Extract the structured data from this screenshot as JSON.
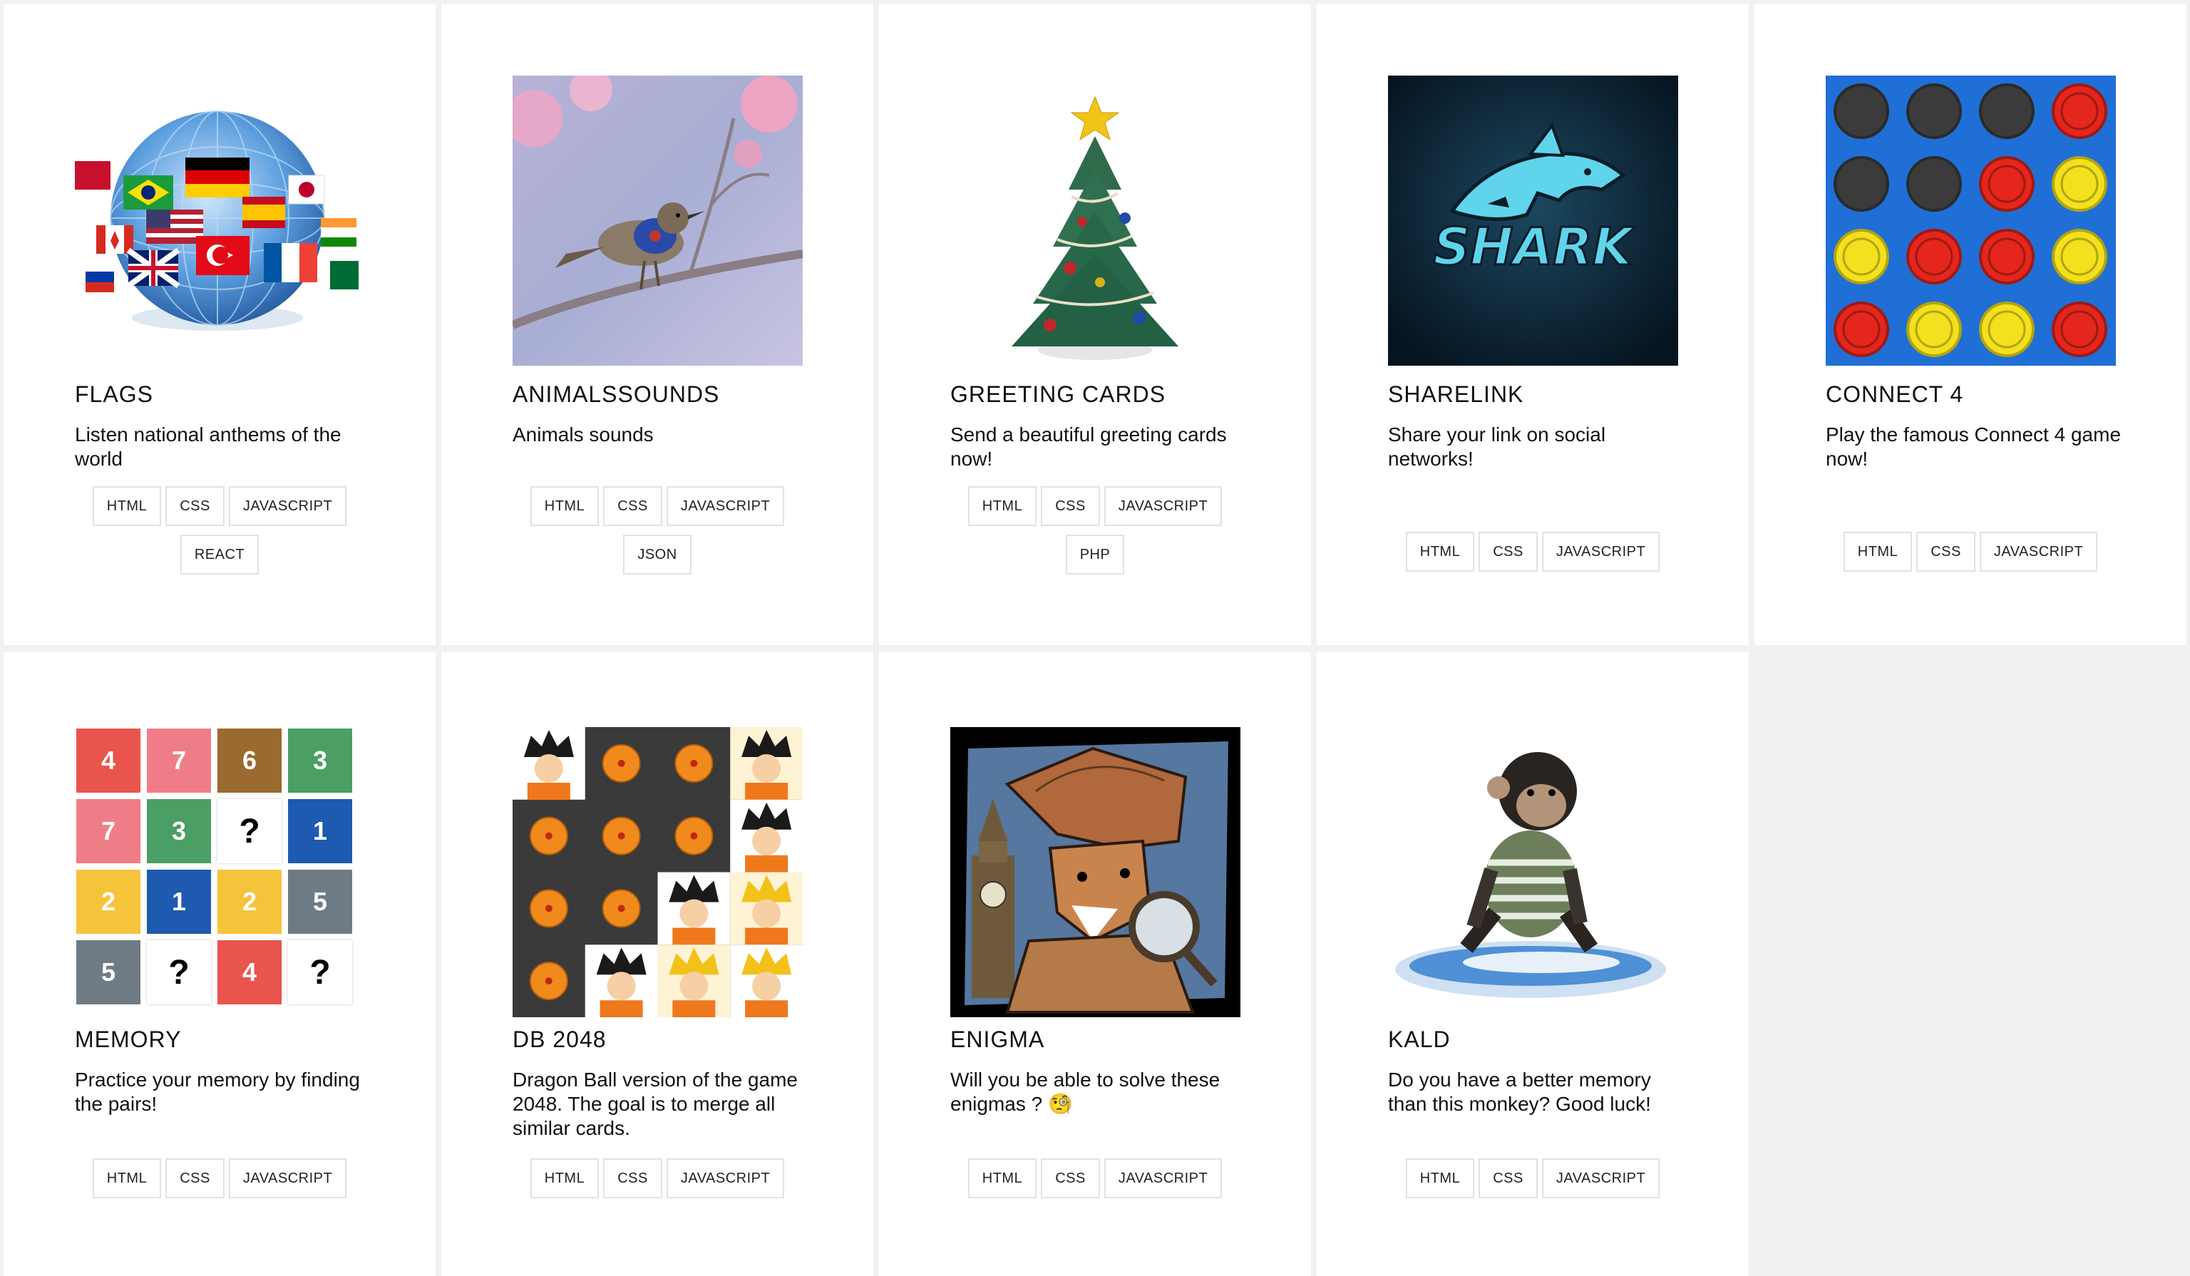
{
  "cards": [
    {
      "title": "FLAGS",
      "desc": "Listen national anthems of the world",
      "thumb": "globe-with-flags",
      "tags": [
        "HTML",
        "CSS",
        "JAVASCRIPT",
        "REACT"
      ]
    },
    {
      "title": "ANIMALSSOUNDS",
      "desc": "Animals sounds",
      "thumb": "bird-on-branch",
      "tags": [
        "HTML",
        "CSS",
        "JAVASCRIPT",
        "JSON"
      ]
    },
    {
      "title": "GREETING CARDS",
      "desc": "Send a beautiful greeting cards now!",
      "thumb": "christmas-tree",
      "tags": [
        "HTML",
        "CSS",
        "JAVASCRIPT",
        "PHP"
      ]
    },
    {
      "title": "SHARELINK",
      "desc": "Share your link on social networks!",
      "thumb": "shark-logo",
      "logo_text": "SHARK",
      "tags": [
        "HTML",
        "CSS",
        "JAVASCRIPT"
      ]
    },
    {
      "title": "CONNECT 4",
      "desc": "Play the famous Connect 4 game now!",
      "thumb": "connect4-board",
      "tags": [
        "HTML",
        "CSS",
        "JAVASCRIPT"
      ]
    },
    {
      "title": "MEMORY",
      "desc": "Practice your memory by finding the pairs!",
      "thumb": "memory-grid",
      "grid": [
        [
          "4",
          "7",
          "6",
          "3"
        ],
        [
          "7",
          "3",
          "?",
          "1"
        ],
        [
          "2",
          "1",
          "2",
          "5"
        ],
        [
          "5",
          "?",
          "4",
          "?"
        ]
      ],
      "tags": [
        "HTML",
        "CSS",
        "JAVASCRIPT"
      ]
    },
    {
      "title": "DB 2048",
      "desc": "Dragon Ball version of the game 2048. The goal is to merge all similar cards.",
      "thumb": "dragonball-2048",
      "tags": [
        "HTML",
        "CSS",
        "JAVASCRIPT"
      ]
    },
    {
      "title": "ENIGMA",
      "desc": "Will you be able to solve these enigmas ? 🧐",
      "thumb": "detective-fox",
      "tags": [
        "HTML",
        "CSS",
        "JAVASCRIPT"
      ]
    },
    {
      "title": "KALD",
      "desc": "Do you have a better memory than this monkey? Good luck!",
      "thumb": "monkey-surfing",
      "tags": [
        "HTML",
        "CSS",
        "JAVASCRIPT"
      ]
    }
  ],
  "colors": {
    "memory_red": "#e9544c",
    "memory_pink": "#ef7d87",
    "memory_brown": "#9a6a2f",
    "memory_green": "#4b9e64",
    "memory_blue": "#1d5ab0",
    "memory_yellow": "#f5c43b",
    "memory_gray": "#6e7b85",
    "connect4_board": "#1f6fd6",
    "connect4_red": "#e4261d",
    "connect4_yellow": "#f3e01e",
    "connect4_empty": "#3b3b3b"
  }
}
